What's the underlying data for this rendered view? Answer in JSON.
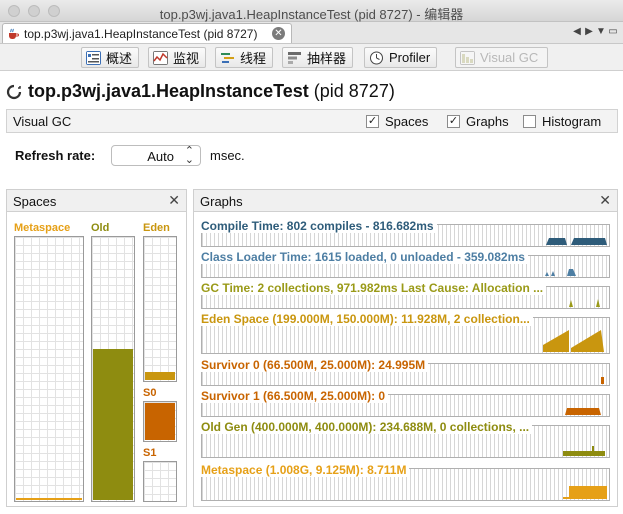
{
  "window": {
    "title": "top.p3wj.java1.HeapInstanceTest (pid 8727) - 编辑器"
  },
  "doc_tab": {
    "label": "top.p3wj.java1.HeapInstanceTest (pid 8727)",
    "close": "✕"
  },
  "view_tabs": [
    {
      "label": "概述",
      "icon": "overview-icon"
    },
    {
      "label": "监视",
      "icon": "monitor-icon"
    },
    {
      "label": "线程",
      "icon": "threads-icon"
    },
    {
      "label": "抽样器",
      "icon": "sampler-icon"
    },
    {
      "label": "Profiler",
      "icon": "profiler-icon"
    },
    {
      "label": "Visual GC",
      "icon": "visual-gc-icon",
      "disabled": true
    }
  ],
  "header": {
    "app_name": "top.p3wj.java1.HeapInstanceTest",
    "pid": "(pid 8727)"
  },
  "visual_gc": {
    "label": "Visual GC",
    "options": [
      {
        "label": "Spaces",
        "checked": true
      },
      {
        "label": "Graphs",
        "checked": true
      },
      {
        "label": "Histogram",
        "checked": false
      }
    ]
  },
  "refresh": {
    "label": "Refresh rate:",
    "value": "Auto",
    "unit": "msec."
  },
  "spaces_panel": {
    "title": "Spaces",
    "close": "✕",
    "spaces": [
      {
        "name": "Metaspace",
        "color": "#e6a017",
        "fill_percent": 1
      },
      {
        "name": "Old",
        "color": "#8e8c10",
        "fill_percent": 58
      },
      {
        "name": "Eden",
        "color": "#c9960f",
        "fill_percent": 7
      },
      {
        "name": "S0",
        "color": "#c86400",
        "fill_percent": 100
      },
      {
        "name": "S1",
        "color": "#c86400",
        "fill_percent": 0
      }
    ]
  },
  "graphs_panel": {
    "title": "Graphs",
    "close": "✕",
    "graphs": [
      {
        "label": "Compile Time: 802 compiles - 816.682ms",
        "color": "#2e5c7a"
      },
      {
        "label": "Class Loader Time: 1615 loaded, 0 unloaded - 359.082ms",
        "color": "#4d7ea3"
      },
      {
        "label": "GC Time: 2 collections, 971.982ms Last Cause: Allocation ...",
        "color": "#9a9a18"
      },
      {
        "label": "Eden Space (199.000M, 150.000M): 11.928M, 2 collection...",
        "color": "#c9960f"
      },
      {
        "label": "Survivor 0 (66.500M, 25.000M): 24.995M",
        "color": "#c86400"
      },
      {
        "label": "Survivor 1 (66.500M, 25.000M): 0",
        "color": "#c86400"
      },
      {
        "label": "Old Gen (400.000M, 400.000M): 234.688M, 0 collections, ...",
        "color": "#8e8c10"
      },
      {
        "label": "Metaspace (1.008G, 9.125M): 8.711M",
        "color": "#e6a017"
      }
    ]
  }
}
